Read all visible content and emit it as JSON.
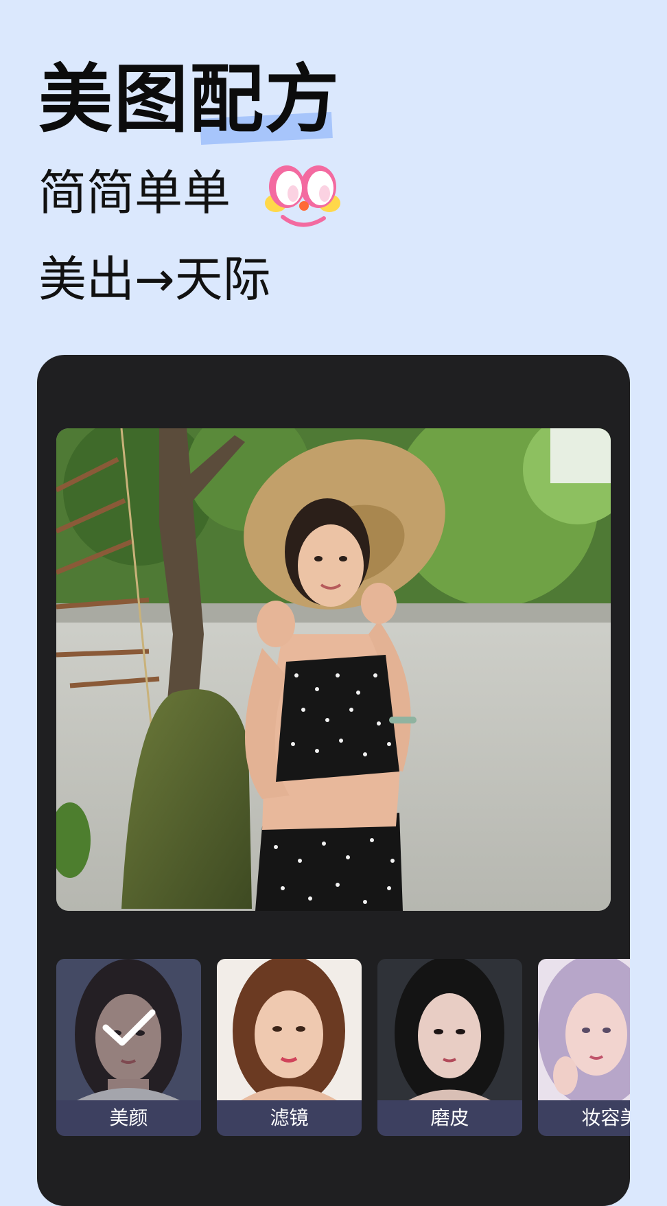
{
  "hero": {
    "title": "美图配方",
    "line1": "简简单单",
    "line2": "美出→天际",
    "emoji_icon": "cute-face-emoji-icon",
    "highlight_color": "#a7c5fb"
  },
  "preview": {
    "photo_icon": "sample-portrait-photo"
  },
  "presets": {
    "items": [
      {
        "label": "美颜",
        "selected": true
      },
      {
        "label": "滤镜",
        "selected": false
      },
      {
        "label": "磨皮",
        "selected": false
      },
      {
        "label": "妆容美",
        "selected": false
      }
    ],
    "check_icon": "checkmark-icon"
  },
  "colors": {
    "background": "#dbe8fd",
    "card": "#1f1f21",
    "label_bar": "#3d4060"
  }
}
